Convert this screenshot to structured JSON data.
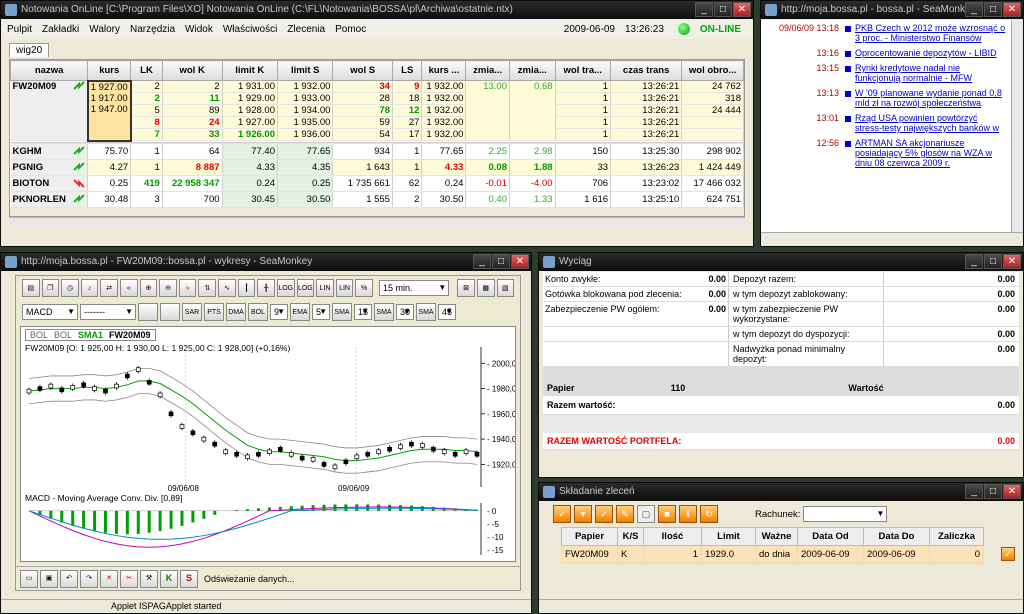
{
  "main": {
    "title": "Notowania OnLine [C:\\Program Files\\XO] Notowania OnLine (C:\\FL\\Notowania\\BOSSA\\pl\\Archiwa\\ostatnie.ntx)",
    "menu": [
      "Pulpit",
      "Zakładki",
      "Walory",
      "Narzędzia",
      "Widok",
      "Właściwości",
      "Zlecenia",
      "Pomoc"
    ],
    "date": "2009-06-09",
    "time": "13:26:23",
    "status": "ON-LINE",
    "tab": "wig20",
    "columns": [
      "nazwa",
      "kurs",
      "LK",
      "wol K",
      "limit K",
      "limit S",
      "wol S",
      "LS",
      "kurs ...",
      "zmia...",
      "zmia...",
      "wol tra...",
      "czas trans",
      "wol obro..."
    ],
    "fw": {
      "name": "FW20M09",
      "kurs": [
        "1 927.00",
        "1 917.00",
        "1 947.00"
      ],
      "lk": [
        "2",
        "2",
        "5",
        "8",
        "7"
      ],
      "wolk": [
        "2",
        "11",
        "89",
        "24",
        "33"
      ],
      "limk": [
        "1 931.00",
        "1 929.00",
        "1 928.00",
        "1 927.00",
        "1 926.00"
      ],
      "lims": [
        "1 932.00",
        "1 933.00",
        "1 934.00",
        "1 935.00",
        "1 936.00"
      ],
      "wols": [
        "34",
        "28",
        "78",
        "59",
        "54"
      ],
      "ls": [
        "9",
        "18",
        "12",
        "27",
        "17"
      ],
      "kurs2": [
        "1 932.00",
        "1 932.00",
        "1 932.00",
        "1 932.00",
        "1 932.00"
      ],
      "zm1": "13.00",
      "zm2": "0.68",
      "woltr": [
        "1",
        "1",
        "1",
        "1",
        "1"
      ],
      "czas": [
        "13:26:21",
        "13:26:21",
        "13:26:21",
        "13:26:21",
        "13:26:21"
      ],
      "wolob": [
        "24 762",
        "318",
        "24 444",
        "",
        ""
      ]
    },
    "rows": [
      {
        "name": "KGHM",
        "kurs": "75.70",
        "lk": "1",
        "wolk": "64",
        "limk": "77.40",
        "lims": "77.65",
        "wols": "934",
        "ls": "1",
        "kurs2": "77.65",
        "zm1": "2.25",
        "zm2": "2.98",
        "woltr": "150",
        "czas": "13:25:30",
        "wolob": "298 902"
      },
      {
        "name": "PGNIG",
        "kurs": "4.27",
        "lk": "1",
        "wolk": "8 887",
        "limk": "4.33",
        "lims": "4.35",
        "wols": "1 643",
        "ls": "1",
        "kurs2": "4.33",
        "zm1": "0.08",
        "zm2": "1.88",
        "woltr": "33",
        "czas": "13:26:23",
        "wolob": "1 424 449"
      },
      {
        "name": "BIOTON",
        "kurs": "0.25",
        "lk": "419",
        "wolk": "22 958 347",
        "limk": "0.24",
        "lims": "0.25",
        "wols": "1 735 661",
        "ls": "62",
        "kurs2": "0.24",
        "zm1": "-0.01",
        "zm2": "-4.00",
        "woltr": "706",
        "czas": "13:23:02",
        "wolob": "17 466 032"
      },
      {
        "name": "PKNORLEN",
        "kurs": "30.48",
        "lk": "3",
        "wolk": "700",
        "limk": "30.45",
        "lims": "30.50",
        "wols": "1 555",
        "ls": "2",
        "kurs2": "30.50",
        "zm1": "0.40",
        "zm2": "1.33",
        "woltr": "1 616",
        "czas": "13:25:10",
        "wolob": "624 751"
      }
    ]
  },
  "news": {
    "title": "http://moja.bossa.pl - bossa.pl - SeaMonkey",
    "items": [
      {
        "time": "09/06/09 13:18",
        "text": "PKB Czech w 2012 może wzrosnąć o 3 proc. - Ministerstwo Finansów"
      },
      {
        "time": "13:16",
        "text": "Oprocentowanie depozytów - LIBID"
      },
      {
        "time": "13:15",
        "text": "Rynki kredytowe nadal nie funkcjonują normalnie - MFW"
      },
      {
        "time": "13:13",
        "text": "W '09 planowane wydanie ponad 0,8 mld zł na rozwój społeczeństwa"
      },
      {
        "time": "13:01",
        "text": "Rząd USA powinien powtórzyć stress-testy największych banków w"
      },
      {
        "time": "12:56",
        "text": "ARTMAN SA akcjonariusze posiadający 5% głosów na WZA w dniu 08 czerwca 2009 r."
      }
    ]
  },
  "chart": {
    "title": "http://moja.bossa.pl - FW20M09::bossa.pl - wykresy - SeaMonkey",
    "interval": "15 min.",
    "indicator": "MACD",
    "indicator2": "-------",
    "b_sar": "SAR",
    "b_pts": "PTS",
    "b_dma": "DMA",
    "b_bol": "BOL",
    "bol_n": "9",
    "b_ema": "EMA",
    "ema_n": "5",
    "b_sma1": "SMA",
    "sma1_n": "15",
    "b_sma2": "SMA",
    "sma2_n": "30",
    "b_sma3": "SMA",
    "sma3_n": "45",
    "legend": [
      "BOL",
      "BOL",
      "SMA1",
      "FW20M09"
    ],
    "info": "FW20M09 [O: 1 925,00  H: 1 930,00  L: 1 925,00  C: 1 928,00] (+0,16%)",
    "macd_label": "MACD - Moving Average Conv. Div. [0,89]",
    "status": "Odświeżanie danych...",
    "applet_status": "Applet ISPAGApplet started"
  },
  "chart_data": {
    "type": "line",
    "title": "FW20M09",
    "x_labels": [
      "09/06/08",
      "09/06/09"
    ],
    "yticks": [
      1920,
      1940,
      1960,
      1980,
      2000
    ],
    "ylim": [
      1910,
      2005
    ],
    "series": [
      {
        "name": "FW20M09",
        "values": [
          1978,
          1980,
          1982,
          1979,
          1981,
          1983,
          1980,
          1978,
          1982,
          1990,
          1995,
          1985,
          1975,
          1960,
          1950,
          1945,
          1940,
          1936,
          1930,
          1928,
          1926,
          1928,
          1930,
          1932,
          1928,
          1925,
          1924,
          1920,
          1918,
          1922,
          1926,
          1928,
          1930,
          1932,
          1934,
          1936,
          1935,
          1932,
          1930,
          1928,
          1930,
          1928
        ]
      },
      {
        "name": "SMA1",
        "values": [
          1978,
          1979,
          1980,
          1980,
          1980,
          1981,
          1981,
          1980,
          1981,
          1983,
          1986,
          1986,
          1984,
          1979,
          1974,
          1968,
          1961,
          1954,
          1947,
          1941,
          1935,
          1932,
          1930,
          1930,
          1929,
          1928,
          1927,
          1926,
          1924,
          1923,
          1923,
          1924,
          1925,
          1927,
          1929,
          1931,
          1932,
          1932,
          1932,
          1931,
          1931,
          1930
        ]
      }
    ],
    "macd": {
      "yticks": [
        0,
        -5,
        -10,
        -15
      ],
      "ylim": [
        -17,
        3
      ]
    }
  },
  "wyciag": {
    "title": "Wyciąg",
    "rows": [
      {
        "l1": "Konto zwykłe:",
        "v1": "0.00",
        "l2": "Depozyt razem:",
        "v2": "0.00"
      },
      {
        "l1": "Gotówka blokowana pod zlecenia:",
        "v1": "0.00",
        "l2": "w tym depozyt zablokowany:",
        "v2": "0.00"
      },
      {
        "l1": "Zabezpieczenie PW ogółem:",
        "v1": "0.00",
        "l2": "w tym zabezpieczenie PW wykorzystane:",
        "v2": "0.00"
      },
      {
        "l1": "",
        "v1": "",
        "l2": "w tym depozyt do dyspozycji:",
        "v2": "0.00"
      },
      {
        "l1": "",
        "v1": "",
        "l2": "Nadwyżka ponad minimalny depozyt:",
        "v2": "0.00"
      }
    ],
    "papier_label": "Papier",
    "papier_qty": "110",
    "wartosc_label": "Wartość",
    "razem_label": "Razem wartość:",
    "razem_val": "0.00",
    "portfel_label": "RAZEM WARTOŚĆ PORTFELA:",
    "portfel_val": "0.00"
  },
  "zlecenia": {
    "title": "Składanie zleceń",
    "rachunek": "Rachunek:",
    "cols": [
      "Papier",
      "K/S",
      "Ilość",
      "Limit",
      "Ważne",
      "Data Od",
      "Data Do",
      "Zaliczka"
    ],
    "row": [
      "FW20M09",
      "K",
      "1",
      "1929.0",
      "do dnia",
      "2009-06-09",
      "2009-06-09",
      "0"
    ]
  }
}
